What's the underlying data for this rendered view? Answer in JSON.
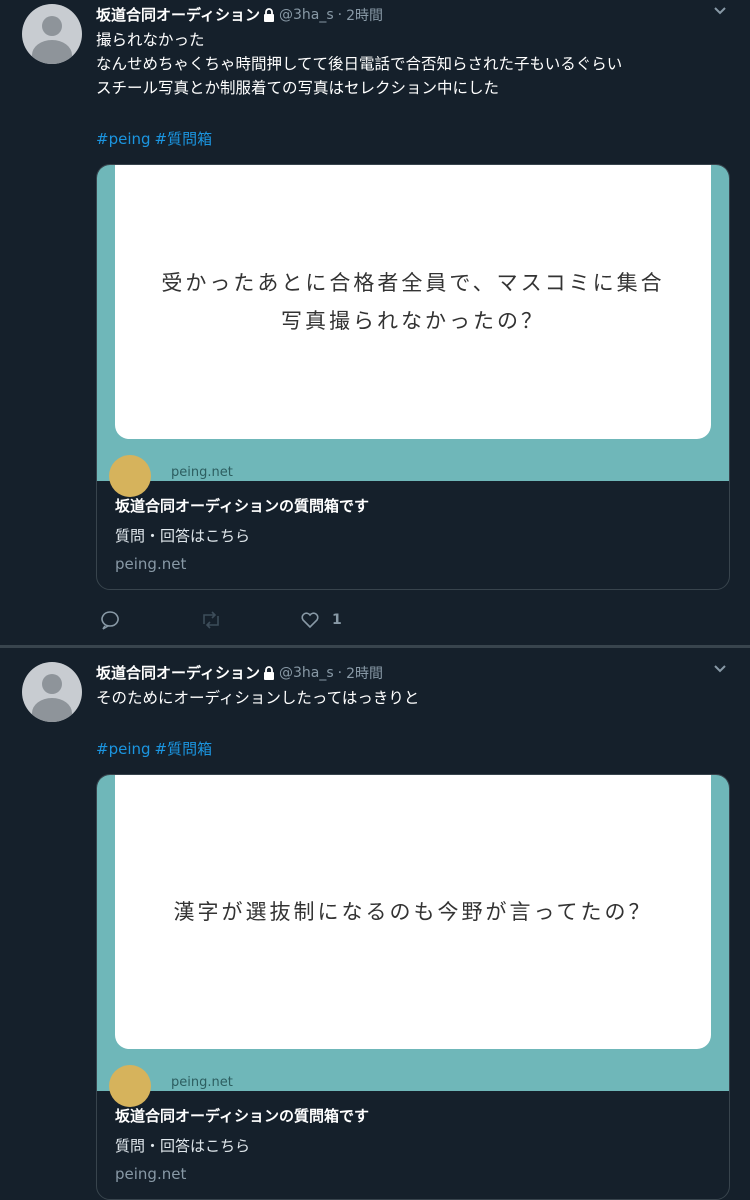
{
  "tweets": [
    {
      "name": "坂道合同オーディション",
      "handle": "@3ha_s",
      "sep": "·",
      "time": "2時間",
      "lines": [
        "撮られなかった",
        "なんせめちゃくちゃ時間押してて後日電話で合否知らされた子もいるぐらい",
        "スチール写真とか制服着ての写真はセレクション中にした"
      ],
      "hashtags": [
        "#peing",
        "#質問箱"
      ],
      "card": {
        "question_lines": [
          "受かったあとに合格者全員で、マスコミに集合",
          "写真撮られなかったの？"
        ],
        "site": "peing.net",
        "title": "坂道合同オーディションの質問箱です",
        "description": "質問・回答はこちら",
        "domain": "peing.net"
      },
      "like_count": "1"
    },
    {
      "name": "坂道合同オーディション",
      "handle": "@3ha_s",
      "sep": "·",
      "time": "2時間",
      "lines": [
        "そのためにオーディションしたってはっきりと"
      ],
      "hashtags": [
        "#peing",
        "#質問箱"
      ],
      "card": {
        "question_lines": [
          "漢字が選抜制になるのも今野が言ってたの？"
        ],
        "site": "peing.net",
        "title": "坂道合同オーディションの質問箱です",
        "description": "質問・回答はこちら",
        "domain": "peing.net"
      }
    }
  ],
  "icons": {
    "lock": "lock-icon",
    "chevron": "chevron-down-icon",
    "reply": "reply-icon",
    "retweet": "retweet-icon",
    "like": "heart-icon"
  },
  "colors": {
    "background": "#15202b",
    "link": "#1b95e0",
    "muted": "#8899a6",
    "card_teal": "#6fb7b9"
  }
}
